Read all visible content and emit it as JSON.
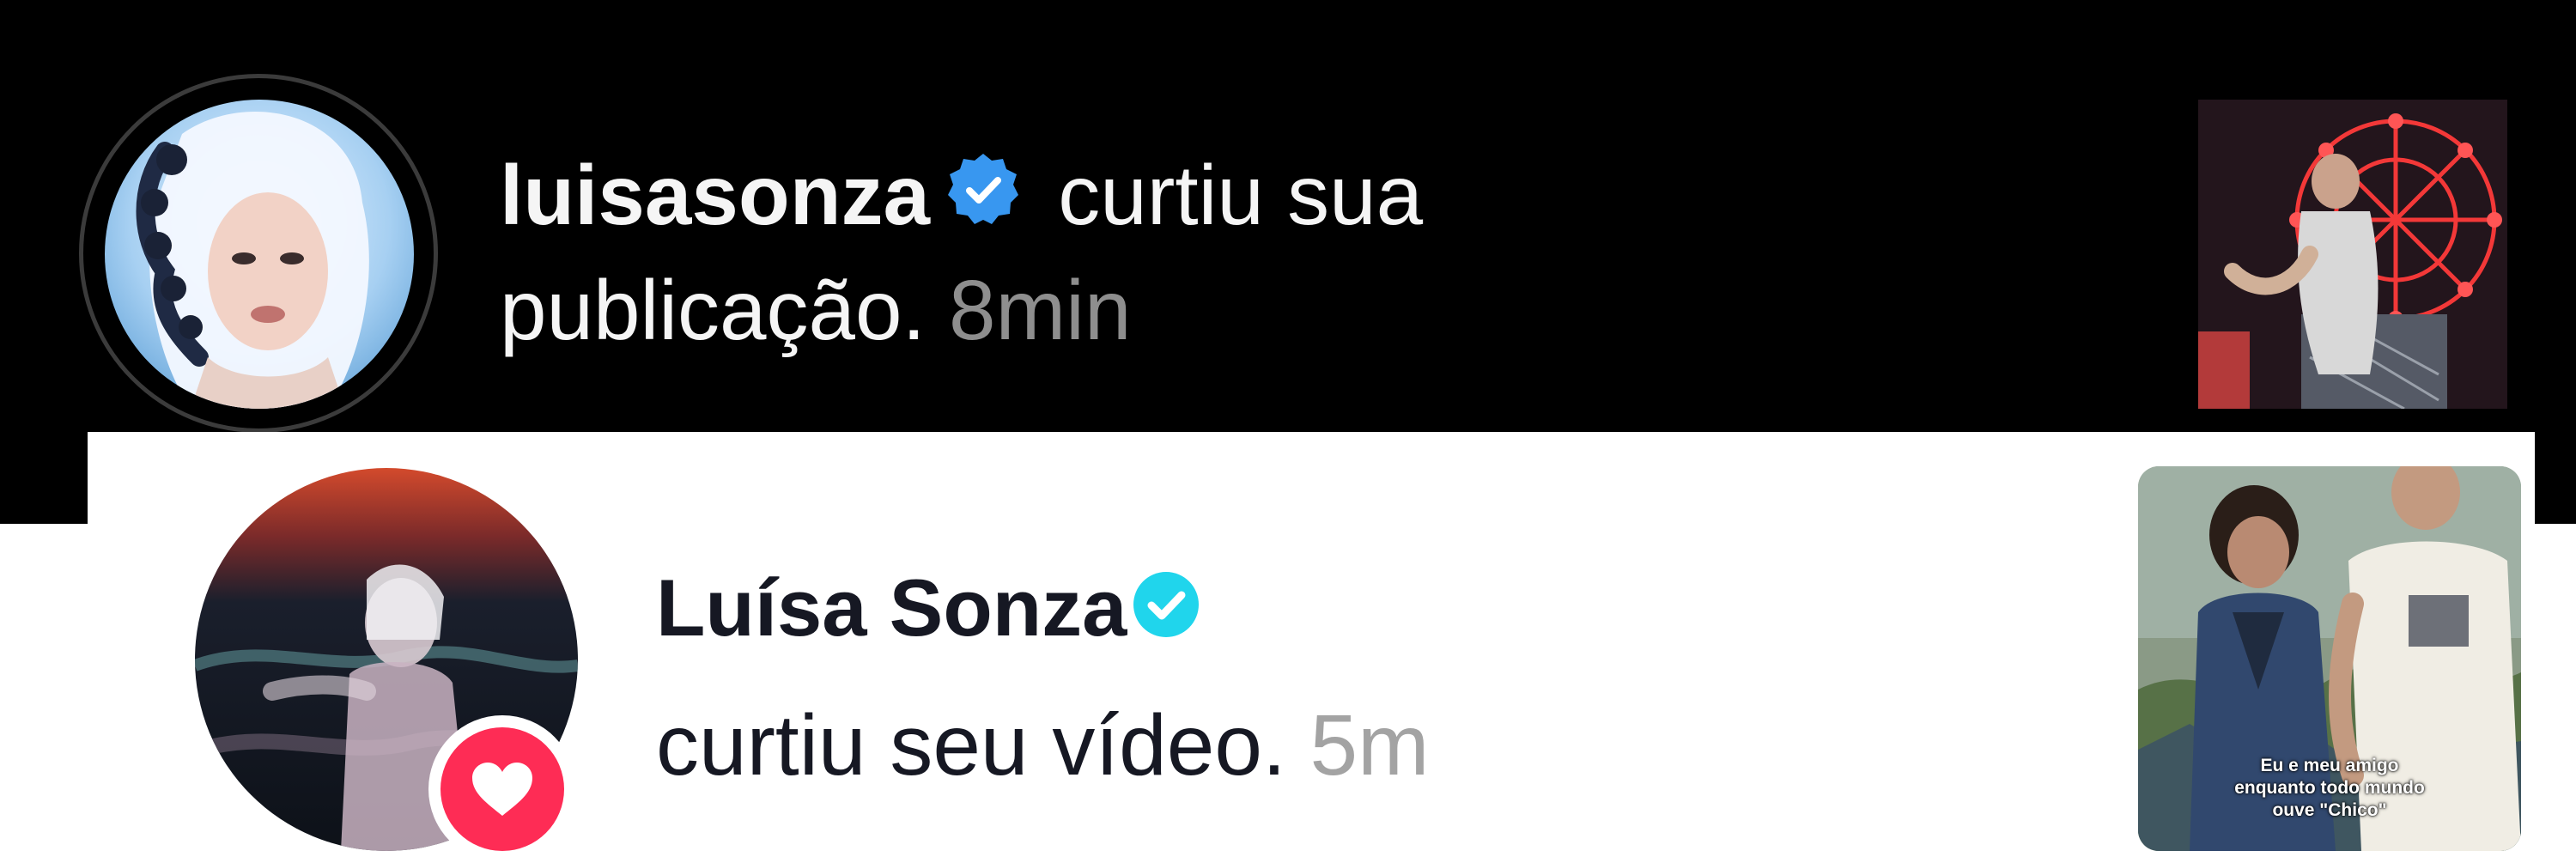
{
  "instagram": {
    "username": "luisasonza",
    "action_line1": " curtiu sua",
    "action_line2": "publicação. ",
    "time": "8min",
    "verified_color": "#3897f0",
    "avatar_icon": "profile-photo",
    "thumbnail_icon": "post-thumbnail"
  },
  "tiktok": {
    "name": "Luísa Sonza",
    "action": "curtiu seu vídeo. ",
    "time": "5m",
    "verified_color": "#20d5ec",
    "badge_color": "#fe2c55",
    "badge_icon": "heart-icon",
    "video_caption_lines": [
      "Eu e meu amigo",
      "enquanto todo mundo",
      "ouve \"Chico\""
    ]
  }
}
